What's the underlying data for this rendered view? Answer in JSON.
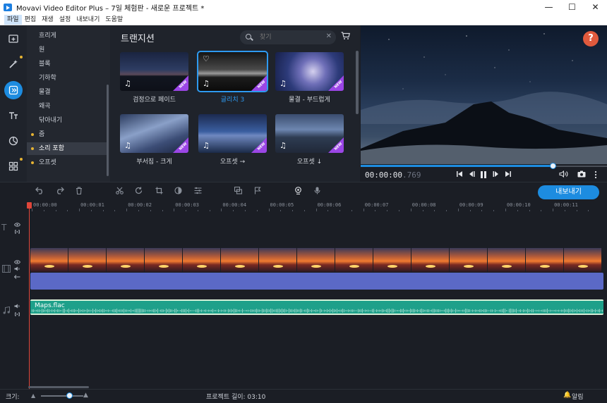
{
  "window": {
    "title": "Movavi Video Editor Plus – 7일 체험판 - 새로운 프로젝트 *",
    "controls": [
      "—",
      "☐",
      "✕"
    ]
  },
  "menu": {
    "items": [
      "파일",
      "편집",
      "재생",
      "설정",
      "내보내기",
      "도움말"
    ],
    "active_index": 0
  },
  "left_tools": [
    "import-icon",
    "magic-wand-icon",
    "transitions-icon",
    "titles-icon",
    "stickers-icon",
    "more-tools-icon"
  ],
  "categories": {
    "items": [
      "흐리게",
      "원",
      "블록",
      "기하학",
      "물결",
      "왜곡",
      "닦아내기",
      "줌",
      "소리 포함",
      "오프셋"
    ],
    "dotted": [
      7,
      8,
      9
    ],
    "selected_index": 8
  },
  "transitions": {
    "title": "트랜지션",
    "search_placeholder": "찾기",
    "new_tag": "NEW",
    "items": [
      {
        "label": "검정으로 페이드",
        "style": "bg-night",
        "new": true,
        "selected": false
      },
      {
        "label": "글리치 3",
        "style": "bg-glitch",
        "new": true,
        "selected": true
      },
      {
        "label": "물결 - 부드럽게",
        "style": "bg-wave",
        "new": true,
        "selected": false
      },
      {
        "label": "부서짐 - 크게",
        "style": "bg-break",
        "new": true,
        "selected": false
      },
      {
        "label": "오프셋 →",
        "style": "bg-off1",
        "new": true,
        "selected": false
      },
      {
        "label": "오프셋 ↓",
        "style": "bg-off2",
        "new": true,
        "selected": false
      }
    ]
  },
  "preview": {
    "help": "?",
    "timecode_main": "00:00:00",
    "timecode_ms": ".769",
    "progress_fraction": 0.78
  },
  "toolbar": {
    "export_label": "내보내기"
  },
  "ruler": {
    "labels": [
      "00:00:00",
      "00:00:01",
      "00:00:02",
      "00:00:03",
      "00:00:04",
      "00:00:05",
      "00:00:06",
      "00:00:07",
      "00:00:08",
      "00:00:09",
      "00:00:10",
      "00:00:11"
    ]
  },
  "timeline": {
    "audio_clip_name": "Maps.flac",
    "video_frame_count": 15
  },
  "status": {
    "zoom_label": "크기:",
    "project_length": "프로젝트 길이: 03:10",
    "notifications": "알림"
  },
  "colors": {
    "accent": "#1d8ce0",
    "help": "#e05a3d",
    "new_tag": "#9b46e6",
    "playhead": "#e0463a",
    "overlay_clip": "#5b69c6",
    "audio_clip": "#1ea08a"
  }
}
